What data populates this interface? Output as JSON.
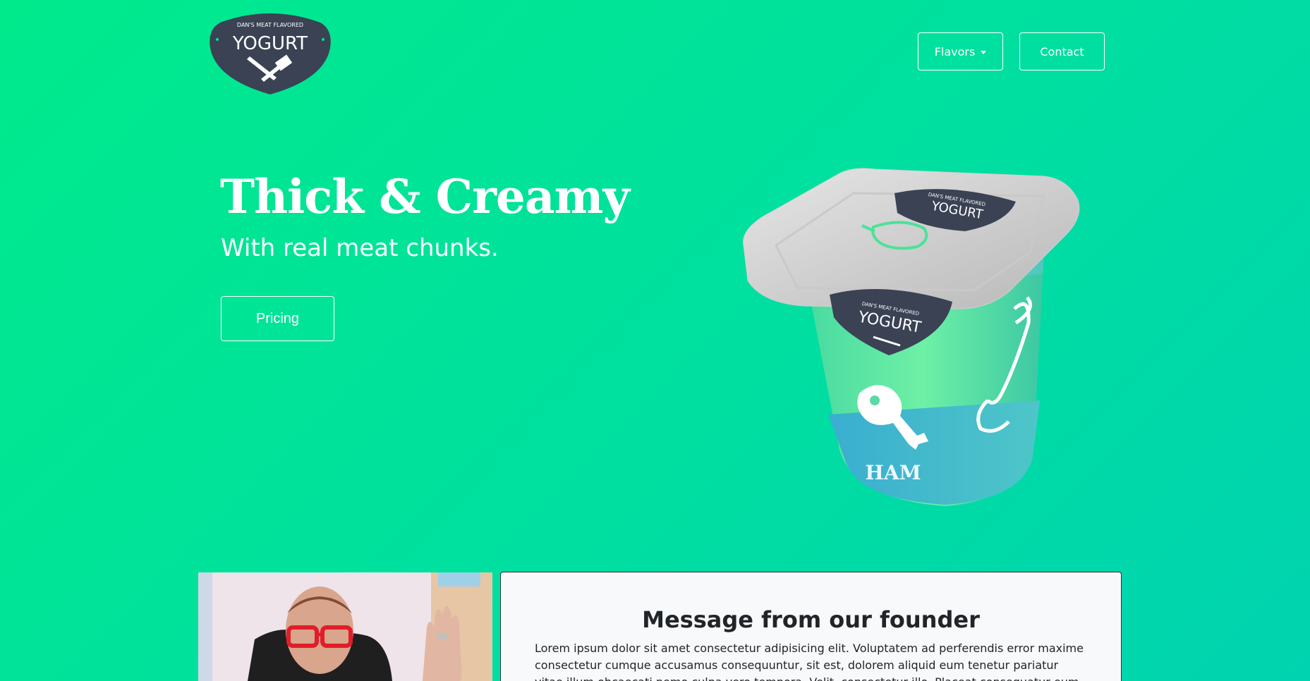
{
  "brand": {
    "logo_top_text": "DAN'S MEAT FLAVORED",
    "logo_main_text": "YOGURT",
    "colors": {
      "badge": "#3a4254",
      "accent": "#00e59a"
    }
  },
  "nav": {
    "flavors_label": "Flavors",
    "contact_label": "Contact"
  },
  "hero": {
    "title": "Thick & Creamy",
    "subtitle": "With real meat chunks.",
    "pricing_label": "Pricing"
  },
  "product": {
    "lid_logo_top": "DAN'S MEAT FLAVORED",
    "lid_logo_main": "YOGURT",
    "cup_logo_top": "DAN'S MEAT FLAVORED",
    "cup_logo_main": "YOGURT",
    "flavor_label": "HAM"
  },
  "founder": {
    "title": "Message from our founder",
    "body": "Lorem ipsum dolor sit amet consectetur adipisicing elit. Voluptatem ad perferendis error maxime consectetur cumque accusamus consequuntur, sit est, dolorem aliquid eum tenetur pariatur vitae illum obcaecati nemo culpa vero tempora. Velit, consectetur illo. Placeat consequatur eum amet doloremque"
  }
}
